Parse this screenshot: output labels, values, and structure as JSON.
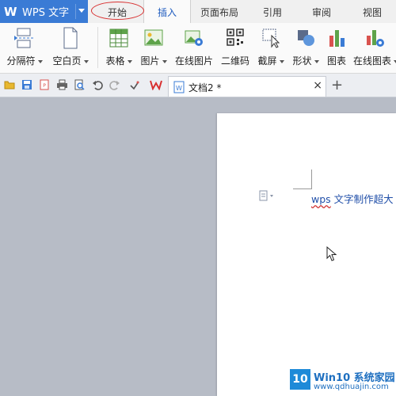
{
  "app": {
    "title": "WPS 文字",
    "logo_letter": "W",
    "accent": "#3a7bd5"
  },
  "menu_tabs": [
    {
      "label": "开始"
    },
    {
      "label": "插入"
    },
    {
      "label": "页面布局"
    },
    {
      "label": "引用"
    },
    {
      "label": "审阅"
    },
    {
      "label": "视图"
    }
  ],
  "active_tab": "插入",
  "ribbon": [
    {
      "label": "分隔符",
      "icon": "page-break-icon",
      "dropdown": true
    },
    {
      "label": "空白页",
      "icon": "blank-page-icon",
      "dropdown": true
    },
    {
      "label": "表格",
      "icon": "table-icon",
      "dropdown": true
    },
    {
      "label": "图片",
      "icon": "picture-icon",
      "dropdown": true
    },
    {
      "label": "在线图片",
      "icon": "online-picture-icon",
      "dropdown": false
    },
    {
      "label": "二维码",
      "icon": "qr-code-icon",
      "dropdown": false
    },
    {
      "label": "截屏",
      "icon": "screenshot-icon",
      "dropdown": true
    },
    {
      "label": "形状",
      "icon": "shapes-icon",
      "dropdown": true
    },
    {
      "label": "图表",
      "icon": "chart-icon",
      "dropdown": false
    },
    {
      "label": "在线图表",
      "icon": "online-chart-icon",
      "dropdown": true
    }
  ],
  "quick_access": [
    "open-folder-icon",
    "save-icon",
    "export-pdf-icon",
    "print-icon",
    "print-preview-icon",
    "undo-icon",
    "redo-icon",
    "format-painter-icon",
    "wps-logo-icon"
  ],
  "document_tab": {
    "name": "文档2 *",
    "close_glyph": "×",
    "new_tab_glyph": "+"
  },
  "document": {
    "text_underlined": "wps",
    "text_rest": " 文字制作超大"
  },
  "watermark": {
    "tile": "10",
    "line1": "Win10 系统家园",
    "line2": "www.qdhuajin.com"
  },
  "highlight_color": "#d83030"
}
